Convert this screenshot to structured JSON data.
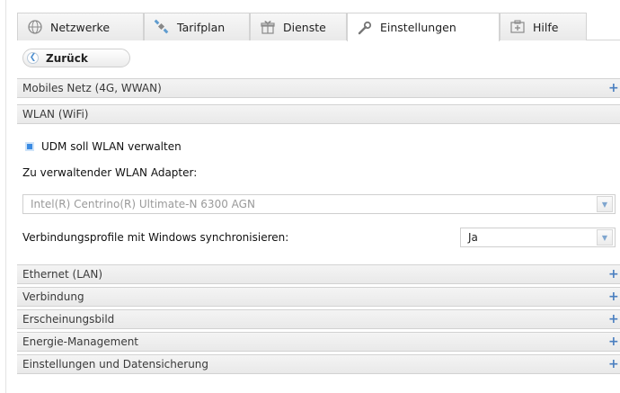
{
  "tabs": [
    {
      "label": "Netzwerke",
      "icon": "globe-icon"
    },
    {
      "label": "Tarifplan",
      "icon": "satellite-icon"
    },
    {
      "label": "Dienste",
      "icon": "gift-icon"
    },
    {
      "label": "Einstellungen",
      "icon": "wrench-icon",
      "active": true
    },
    {
      "label": "Hilfe",
      "icon": "help-icon"
    }
  ],
  "back_label": "Zurück",
  "sections": {
    "mobile": "Mobiles Netz (4G, WWAN)",
    "wlan": "WLAN (WiFi)",
    "ethernet": "Ethernet (LAN)",
    "connection": "Verbindung",
    "appearance": "Erscheinungsbild",
    "energy": "Energie-Management",
    "backup": "Einstellungen und Datensicherung"
  },
  "expand_symbol": "+",
  "wlan": {
    "manage_checkbox_label": "UDM soll WLAN verwalten",
    "manage_checked": true,
    "adapter_label": "Zu verwaltender WLAN Adapter:",
    "adapter_value": "Intel(R) Centrino(R) Ultimate-N 6300 AGN",
    "sync_label": "Verbindungsprofile mit Windows synchronisieren:",
    "sync_value": "Ja"
  },
  "colors": {
    "accent": "#3a8be3",
    "plus": "#4a7fc0"
  }
}
